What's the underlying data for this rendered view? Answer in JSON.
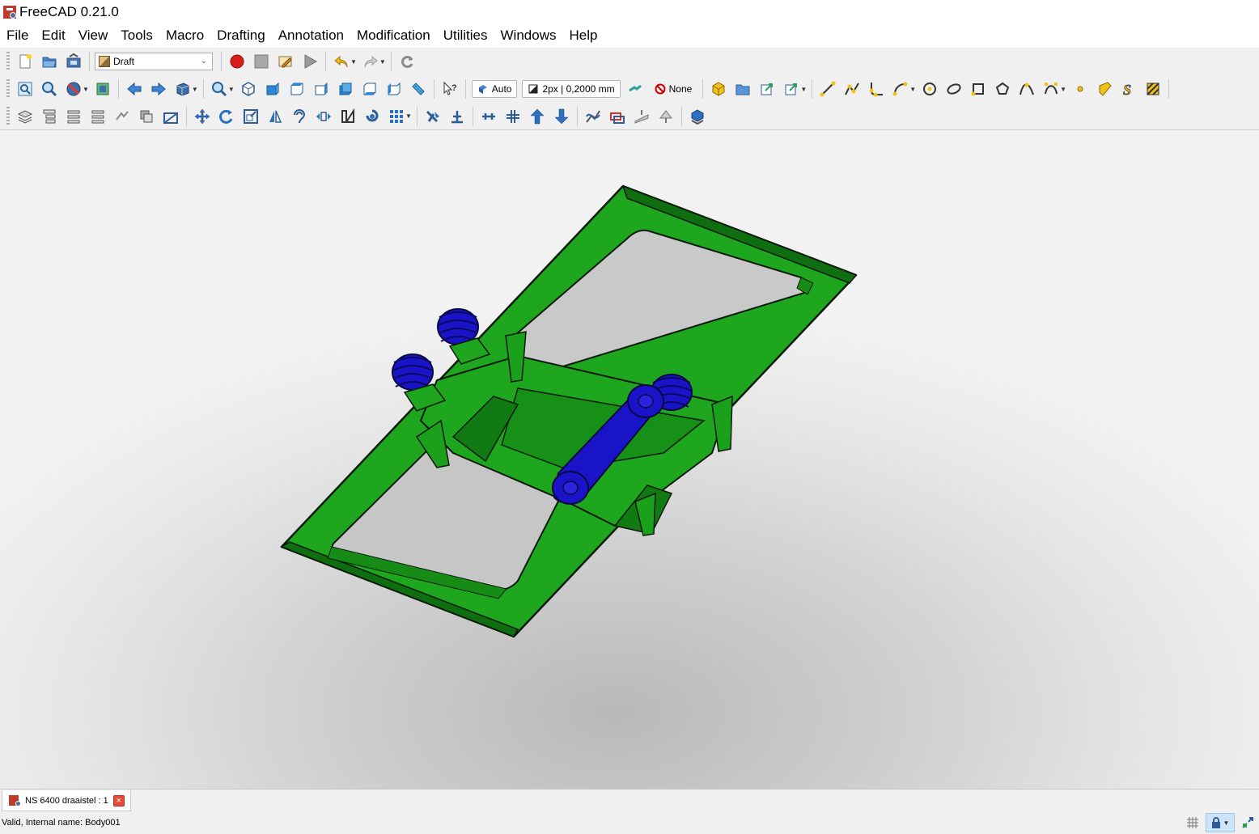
{
  "window": {
    "title": "FreeCAD 0.21.0"
  },
  "menu": [
    "File",
    "Edit",
    "View",
    "Tools",
    "Macro",
    "Drafting",
    "Annotation",
    "Modification",
    "Utilities",
    "Windows",
    "Help"
  ],
  "toolbar": {
    "workbench": "Draft",
    "snap_mode": "Auto",
    "line_style": "2px | 0,2000 mm",
    "group": "None"
  },
  "document_tab": {
    "label": "NS 6400 draaistel : 1",
    "close": "×"
  },
  "status": {
    "message": "Valid, Internal name: Body001"
  },
  "colors": {
    "frame": "#1ea01e",
    "frame_dark": "#0f6e0f",
    "springs": "#1a14c8",
    "outline": "#0a1a0a"
  }
}
